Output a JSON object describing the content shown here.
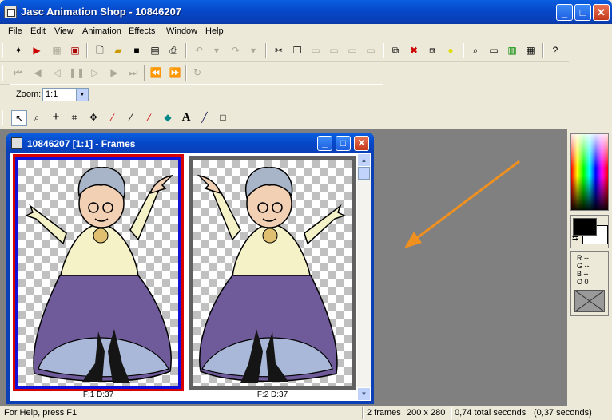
{
  "window": {
    "title": "Jasc Animation Shop - 10846207"
  },
  "menubar": [
    "File",
    "Edit",
    "View",
    "Animation",
    "Effects",
    "Window",
    "Help"
  ],
  "zoom": {
    "label": "Zoom:",
    "value": "1:1"
  },
  "child_window": {
    "title": "10846207 [1:1] - Frames"
  },
  "frames": [
    {
      "label": "F:1   D:37",
      "selected": true
    },
    {
      "label": "F:2   D:37",
      "selected": false
    }
  ],
  "color_panel": {
    "r": "R --",
    "g": "G --",
    "b": "B --",
    "o": "O 0"
  },
  "statusbar": {
    "help": "For Help, press F1",
    "frames": "2 frames",
    "size": "200 x 280",
    "time": "0,74 total seconds",
    "time_sel": "(0,37 seconds)"
  },
  "colors": {
    "accent_blue": "#0a3fb5",
    "selection_blue": "#1010d8",
    "selection_red": "#d80000",
    "workspace_gray": "#808080",
    "arrow_orange": "#f0901e"
  },
  "icons": [
    "app-icon",
    "minimize-icon",
    "maximize-icon",
    "close-icon",
    "text-tool-icon",
    "rectangle-tool-icon",
    "zoom-icon",
    "arrow-icon"
  ]
}
